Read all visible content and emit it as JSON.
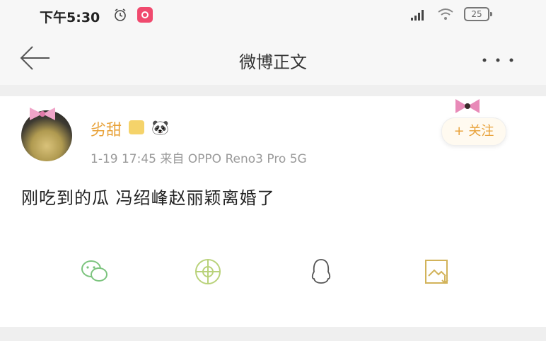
{
  "status_bar": {
    "time": "下午5:30",
    "battery_level": "25",
    "icons": [
      "alarm-icon",
      "app-badge-icon",
      "signal-icon",
      "wifi-icon",
      "battery-icon"
    ]
  },
  "nav": {
    "title": "微博正文",
    "back_icon": "arrow-left-icon",
    "more_icon": "more-dots-icon"
  },
  "post": {
    "username": "劣甜",
    "timestamp": "1-19 17:45",
    "source": "来自 OPPO Reno3 Pro 5G",
    "follow_label": "+ 关注",
    "text": "刚吃到的瓜 冯绍峰赵丽颖离婚了"
  },
  "share_actions": [
    {
      "name": "wechat",
      "icon": "wechat-icon"
    },
    {
      "name": "moments",
      "icon": "moments-icon"
    },
    {
      "name": "qq",
      "icon": "qq-icon"
    },
    {
      "name": "save-image",
      "icon": "save-image-icon"
    }
  ],
  "colors": {
    "accent": "#e8a23a",
    "background": "#f7f7f7",
    "divider": "#efefef"
  }
}
